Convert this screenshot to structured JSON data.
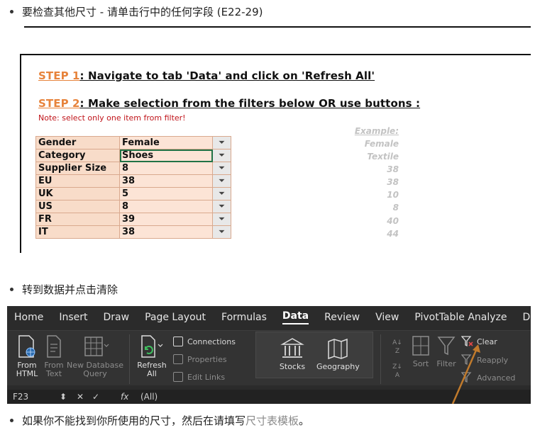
{
  "bullets": {
    "first": "要检查其他尺寸 - 请单击行中的任何字段 (E22-29)",
    "second": "转到数据并点击清除",
    "third_prefix": "如果你不能找到你所使用的尺寸，然后在请填写",
    "third_link": "尺寸表模板",
    "third_suffix": "。"
  },
  "sheet": {
    "step1_num": "STEP 1",
    "step1_text": ": Navigate to tab 'Data' and click on 'Refresh All'",
    "step2_num": "STEP 2",
    "step2_text": ": Make selection from the filters below OR use buttons :",
    "note": "Note: select only one item from filter!",
    "example_header": "Example:",
    "rows": [
      {
        "label": "Gender",
        "value": "Female",
        "example": "Female"
      },
      {
        "label": "Category",
        "value": "Shoes",
        "example": "Textile"
      },
      {
        "label": "Supplier Size",
        "value": "8",
        "example": "38"
      },
      {
        "label": "EU",
        "value": "38",
        "example": "38"
      },
      {
        "label": "UK",
        "value": "5",
        "example": "10"
      },
      {
        "label": "US",
        "value": "8",
        "example": "8"
      },
      {
        "label": "FR",
        "value": "39",
        "example": "40"
      },
      {
        "label": "IT",
        "value": "38",
        "example": "44"
      }
    ],
    "filter_glyph": "⏷",
    "colors": {
      "step_accent": "#e7833b",
      "note": "#c0141a",
      "label_fill": "#f8dcc9",
      "value_fill": "#fce4d6",
      "selection": "#217346"
    }
  },
  "ribbon": {
    "tabs": [
      "Home",
      "Insert",
      "Draw",
      "Page Layout",
      "Formulas",
      "Data",
      "Review",
      "View",
      "PivotTable Analyze",
      "Design"
    ],
    "active_tab": "Data",
    "from_html": [
      "From",
      "HTML"
    ],
    "from_text": [
      "From",
      "Text"
    ],
    "new_query": [
      "New Database",
      "Query"
    ],
    "refresh_all": [
      "Refresh",
      "All"
    ],
    "connections": "Connections",
    "properties": "Properties",
    "edit_links": "Edit Links",
    "stocks": "Stocks",
    "geography": "Geography",
    "sort": "Sort",
    "filter": "Filter",
    "clear": "Clear",
    "reapply": "Reapply",
    "advanced": "Advanced",
    "cell_ref": "F23",
    "fx": "fx",
    "formula_value": "(All)",
    "colors": {
      "ribbon_bg": "#2b2b2b",
      "arrow": "#c07a2c"
    }
  }
}
